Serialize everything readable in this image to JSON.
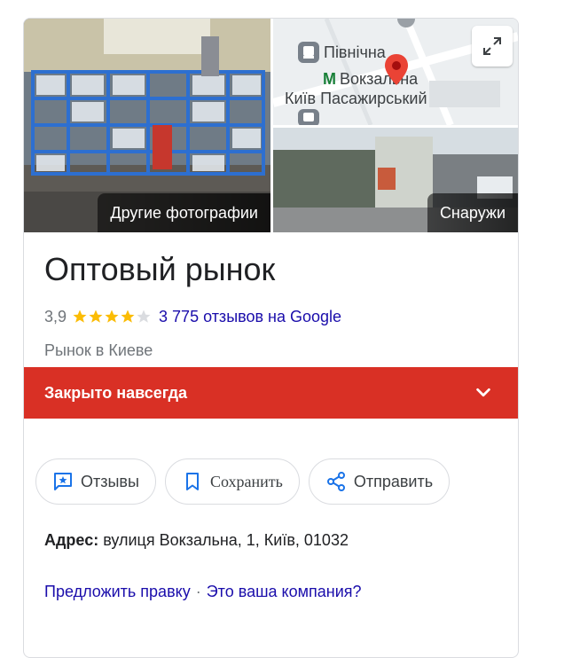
{
  "photos": {
    "main_label": "Другие фотографии",
    "outside_label": "Снаружи",
    "map": {
      "label_north": "Північна",
      "label_station": "Вокзальна",
      "label_passenger": "Київ Пасажирський"
    }
  },
  "place": {
    "title": "Оптовый рынок",
    "rating": "3,9",
    "stars_filled": 4,
    "stars_total": 5,
    "reviews_link": "3 775 отзывов на Google",
    "category": "Рынок в Киеве"
  },
  "status": {
    "closed_text": "Закрыто навсегда",
    "color": "#d93025"
  },
  "actions": {
    "reviews": "Отзывы",
    "save": "Сохранить",
    "share": "Отправить"
  },
  "address": {
    "label": "Адрес:",
    "value": "вулиця Вокзальна, 1, Київ, 01032"
  },
  "links": {
    "suggest_edit": "Предложить правку",
    "separator": "·",
    "own_business": "Это ваша компания?"
  },
  "colors": {
    "link": "#1a0dab",
    "star": "#fbbc04",
    "accent": "#1a73e8"
  }
}
